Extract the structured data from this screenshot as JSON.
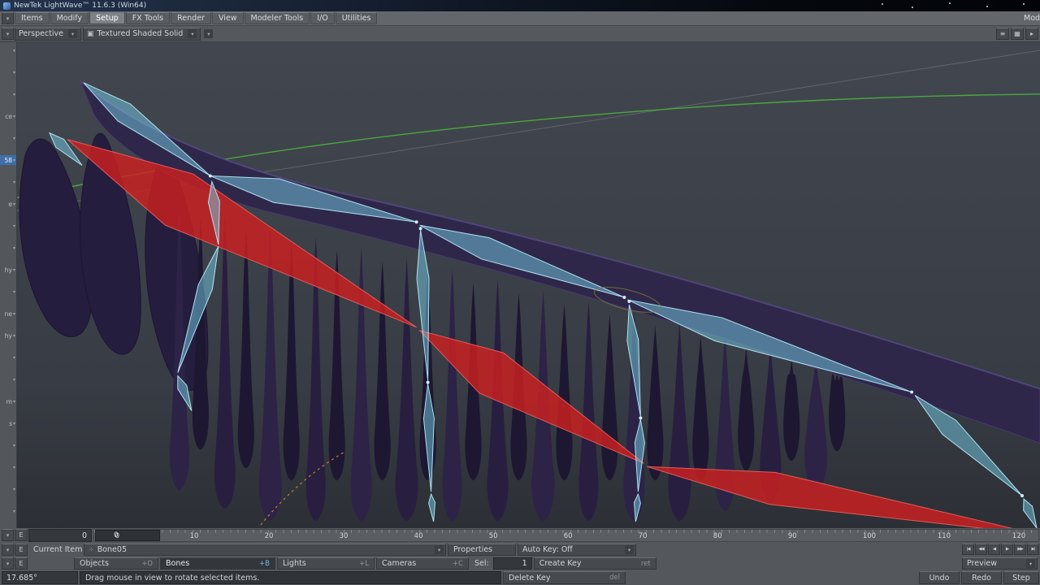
{
  "title_bar": {
    "title": "NewTek LightWave™ 11.6.3 (Win64)"
  },
  "menu": {
    "items": [
      "Items",
      "Modify",
      "Setup",
      "FX Tools",
      "Render",
      "View",
      "Modeler Tools",
      "I/O",
      "Utilities"
    ],
    "right_truncated": "Mod"
  },
  "viewport_bar": {
    "view_mode": "Perspective",
    "shading_mode": "Textured Shaded Solid"
  },
  "left_panel": {
    "fragments": [
      "ce",
      "58",
      "e",
      "hy",
      "ne",
      "hy",
      "m",
      "s"
    ]
  },
  "timeline": {
    "frame_field": "0",
    "slider_label": "0",
    "ticks": [
      "0",
      "10",
      "20",
      "30",
      "40",
      "50",
      "60",
      "70",
      "80",
      "90",
      "100",
      "110",
      "120"
    ],
    "envelope_label": "E"
  },
  "current_item_row": {
    "label": "Current Item",
    "value": "Bone05",
    "properties": "Properties",
    "auto_key": "Auto Key: Off"
  },
  "item_buttons": {
    "objects": "Objects",
    "objects_key": "+O",
    "bones": "Bones",
    "bones_key": "+B",
    "lights": "Lights",
    "lights_key": "+L",
    "cameras": "Cameras",
    "cameras_key": "+C",
    "sel_label": "Sel:",
    "sel_value": "1",
    "create_key": "Create Key",
    "create_key_shortcut": "ret",
    "delete_key": "Delete Key",
    "delete_key_shortcut": "del"
  },
  "transport": {
    "buttons": [
      "|◀",
      "◀◀",
      "◀",
      "▶",
      "▶▶",
      "▶|"
    ]
  },
  "right_controls": {
    "preview": "Preview",
    "undo": "Undo",
    "redo": "Redo",
    "step": "Step"
  },
  "status_bar": {
    "angle": "17.685°",
    "message": "Drag mouse in view to rotate selected items."
  },
  "scene_colors": {
    "body_purple": "#2f2749",
    "bone_cyan": "#76cde8",
    "bone_selected_red": "#cd2020",
    "motion_path_green": "#4aa83e",
    "background": "#3d414a"
  }
}
